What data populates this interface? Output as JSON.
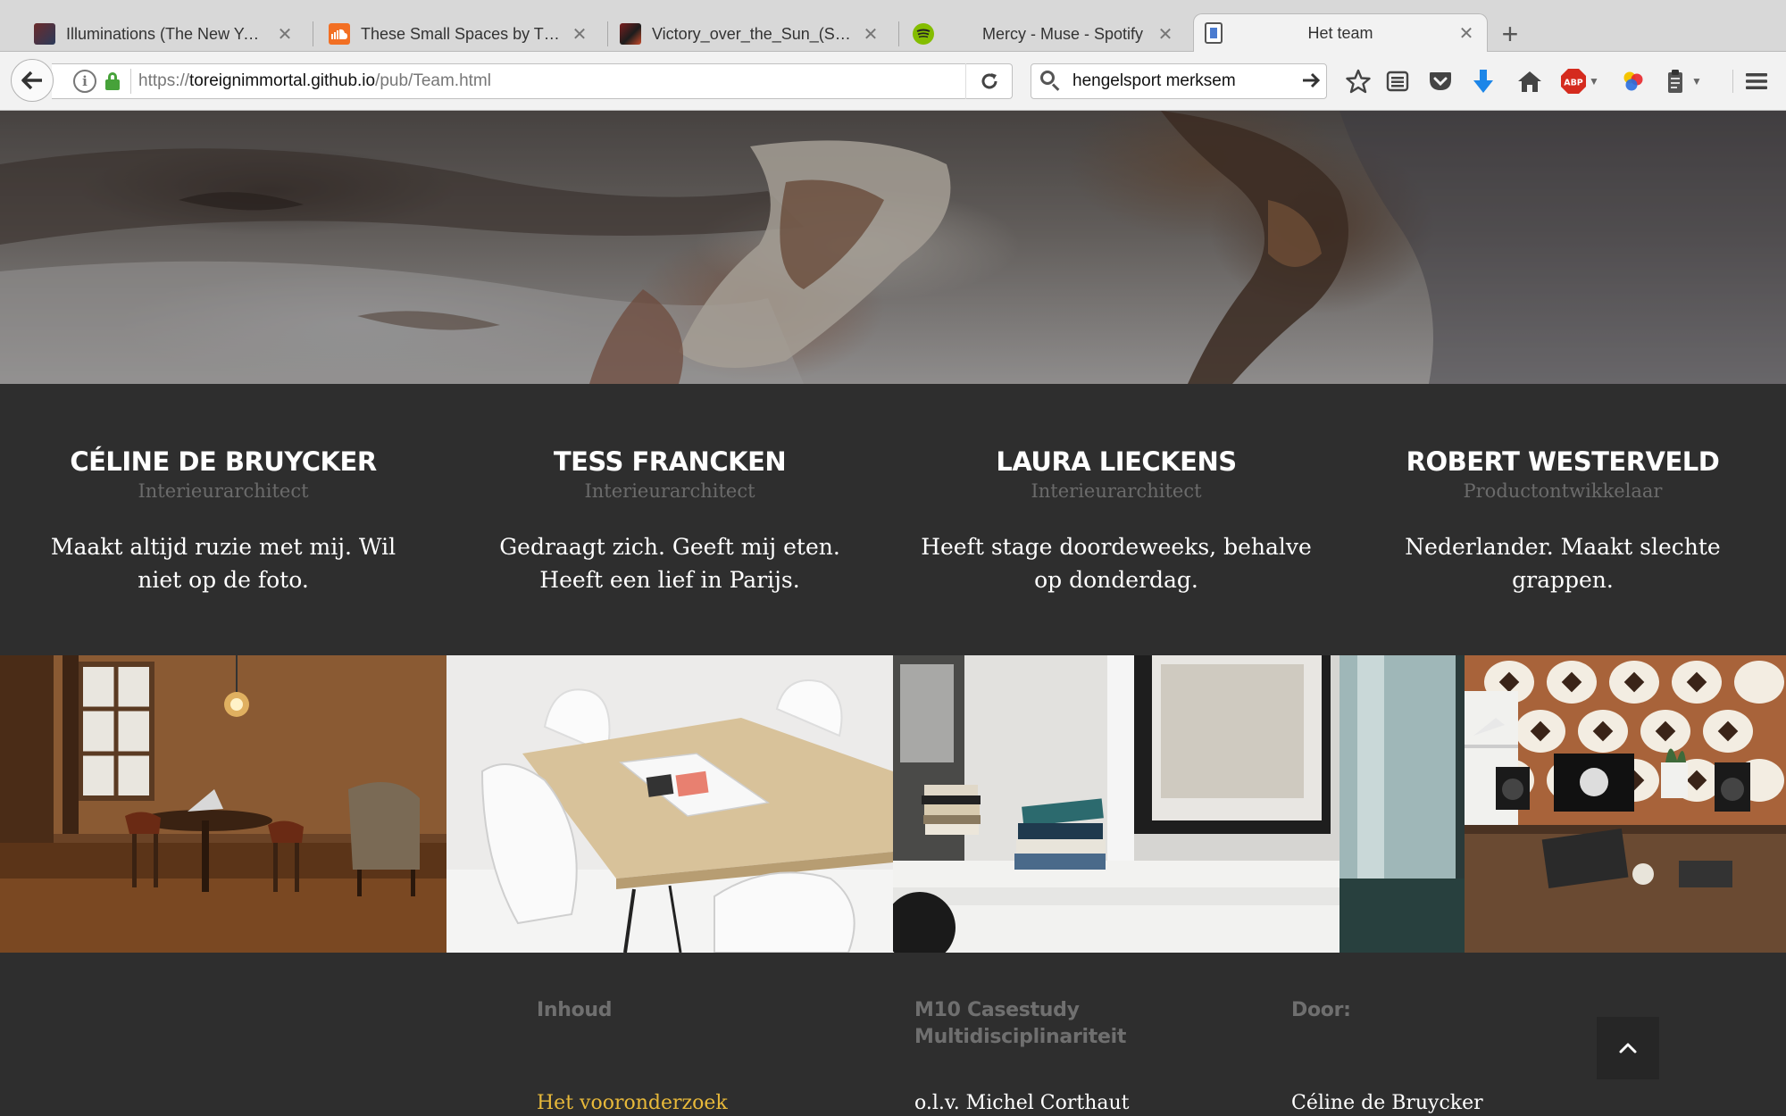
{
  "browser": {
    "tabs": [
      {
        "title": "Illuminations (The New Yea...",
        "icon": "painting-favicon-icon",
        "active": false
      },
      {
        "title": "These Small Spaces by Thi...",
        "icon": "soundcloud-icon",
        "active": false
      },
      {
        "title": "Victory_over_the_Sun_(Stas...",
        "icon": "painting-favicon-icon",
        "active": false
      },
      {
        "title": "Mercy - Muse - Spotify",
        "icon": "spotify-icon",
        "active": false
      },
      {
        "title": "Het team",
        "icon": "page-favicon-icon",
        "active": true
      }
    ],
    "url": {
      "scheme": "https://",
      "host": "toreignimmortal.github.io",
      "path": "/pub/Team.html"
    },
    "search_value": "hengelsport merksem",
    "toolbar_icons": [
      "bookmark-star-icon",
      "reading-list-icon",
      "pocket-icon",
      "download-icon",
      "home-icon",
      "adblock-plus-icon",
      "colorful-extension-icon",
      "clipboard-extension-icon",
      "menu-icon"
    ],
    "adblock_label": "ABP"
  },
  "team": [
    {
      "name": "CÉLINE DE BRUYCKER",
      "role": "Interieurarchitect",
      "bio": "Maakt altijd ruzie met mij. Wil niet op de foto."
    },
    {
      "name": "TESS FRANCKEN",
      "role": "Interieurarchitect",
      "bio": "Gedraagt zich. Geeft mij eten. Heeft een lief in Parijs."
    },
    {
      "name": "LAURA LIECKENS",
      "role": "Interieurarchitect",
      "bio": "Heeft stage doordeweeks, behalve op donderdag."
    },
    {
      "name": "ROBERT WESTERVELD",
      "role": "Productontwikkelaar",
      "bio": "Nederlander. Maakt slechte grappen."
    }
  ],
  "footer": {
    "col1": {
      "heading": "Inhoud",
      "first_link": "Het vooronderzoek"
    },
    "col2": {
      "heading": "M10 Casestudy Multidisciplinariteit",
      "line": "o.l.v. Michel Corthaut"
    },
    "col3": {
      "heading": "Door:",
      "line": "Céline de Bruycker"
    }
  },
  "colors": {
    "accent_link": "#e8b93a",
    "page_bg": "#2e2e2e",
    "role_text": "#6b6b6b"
  }
}
